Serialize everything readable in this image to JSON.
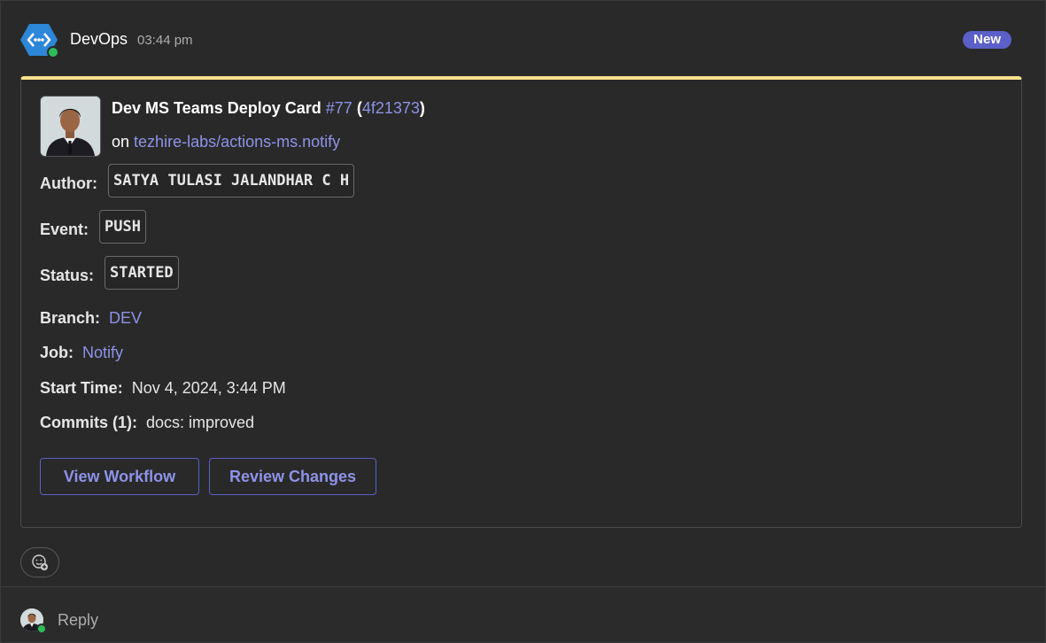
{
  "message": {
    "app_name": "DevOps",
    "time": "03:44 pm",
    "badge": "New",
    "app_icon": "azure-devops-icon",
    "presence_color": "#2ebd59"
  },
  "card": {
    "accent_color": "#f8e08c",
    "avatar_icon": "user-avatar",
    "title": "Dev MS Teams Deploy Card",
    "run_number": "#77",
    "commit_open": "(",
    "commit_sha": "4f21373",
    "commit_close": ")",
    "repo_prefix": "on",
    "repo": "tezhire-labs/actions-ms.notify",
    "fields": {
      "author_label": "Author:",
      "author_value": "SATYA TULASI JALANDHAR C H",
      "event_label": "Event:",
      "event_value": "PUSH",
      "status_label": "Status:",
      "status_value": "STARTED",
      "branch_label": "Branch:",
      "branch_value": "DEV",
      "job_label": "Job:",
      "job_value": "Notify",
      "start_label": "Start Time:",
      "start_value": "Nov 4, 2024, 3:44 PM",
      "commits_label": "Commits (1):",
      "commits_value": "docs: improved"
    },
    "actions": {
      "view_workflow": "View Workflow",
      "review_changes": "Review Changes"
    }
  },
  "reactions": {
    "icon": "add-reaction-icon"
  },
  "reply": {
    "placeholder": "Reply"
  },
  "colors": {
    "link": "#8f92e8",
    "brand": "#5b5fc7",
    "background": "#292929"
  }
}
